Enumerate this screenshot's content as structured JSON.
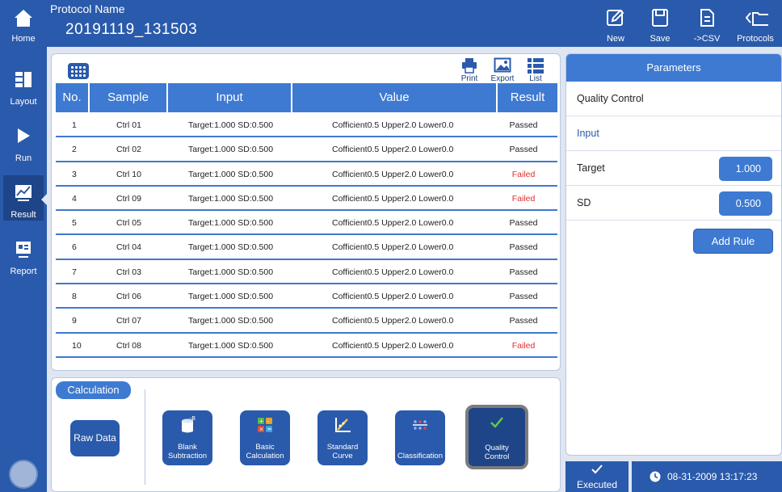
{
  "header": {
    "home_label": "Home",
    "protocol_caption": "Protocol Name",
    "protocol_name": "20191119_131503",
    "buttons": [
      {
        "label": "New",
        "icon": "edit-icon"
      },
      {
        "label": "Save",
        "icon": "save-icon"
      },
      {
        "label": "->CSV",
        "icon": "document-icon"
      },
      {
        "label": "Protocols",
        "icon": "folder-back-icon"
      }
    ]
  },
  "sidebar": {
    "items": [
      {
        "label": "Layout",
        "icon": "layout-icon"
      },
      {
        "label": "Run",
        "icon": "play-icon"
      },
      {
        "label": "Result",
        "icon": "chart-icon",
        "active": true
      },
      {
        "label": "Report",
        "icon": "report-icon"
      }
    ]
  },
  "toolbar": {
    "print_label": "Print",
    "export_label": "Export",
    "list_label": "List"
  },
  "table": {
    "columns": [
      "No.",
      "Sample",
      "Input",
      "Value",
      "Result"
    ],
    "rows": [
      {
        "no": "1",
        "sample": "Ctrl 01",
        "input": "Target:1.000  SD:0.500",
        "value": "Cofficient0.5  Upper2.0  Lower0.0",
        "result": "Passed"
      },
      {
        "no": "2",
        "sample": "Ctrl 02",
        "input": "Target:1.000  SD:0.500",
        "value": "Cofficient0.5  Upper2.0  Lower0.0",
        "result": "Passed"
      },
      {
        "no": "3",
        "sample": "Ctrl 10",
        "input": "Target:1.000  SD:0.500",
        "value": "Cofficient0.5  Upper2.0  Lower0.0",
        "result": "Failed"
      },
      {
        "no": "4",
        "sample": "Ctrl 09",
        "input": "Target:1.000  SD:0.500",
        "value": "Cofficient0.5  Upper2.0  Lower0.0",
        "result": "Failed"
      },
      {
        "no": "5",
        "sample": "Ctrl 05",
        "input": "Target:1.000  SD:0.500",
        "value": "Cofficient0.5  Upper2.0  Lower0.0",
        "result": "Passed"
      },
      {
        "no": "6",
        "sample": "Ctrl 04",
        "input": "Target:1.000  SD:0.500",
        "value": "Cofficient0.5  Upper2.0  Lower0.0",
        "result": "Passed"
      },
      {
        "no": "7",
        "sample": "Ctrl 03",
        "input": "Target:1.000  SD:0.500",
        "value": "Cofficient0.5  Upper2.0  Lower0.0",
        "result": "Passed"
      },
      {
        "no": "8",
        "sample": "Ctrl 06",
        "input": "Target:1.000  SD:0.500",
        "value": "Cofficient0.5  Upper2.0  Lower0.0",
        "result": "Passed"
      },
      {
        "no": "9",
        "sample": "Ctrl 07",
        "input": "Target:1.000  SD:0.500",
        "value": "Cofficient0.5  Upper2.0  Lower0.0",
        "result": "Passed"
      },
      {
        "no": "10",
        "sample": "Ctrl 08",
        "input": "Target:1.000  SD:0.500",
        "value": "Cofficient0.5  Upper2.0  Lower0.0",
        "result": "Failed"
      }
    ]
  },
  "calculation": {
    "tab_label": "Calculation",
    "raw_data_label": "Raw Data",
    "buttons": [
      {
        "line1": "Blank",
        "line2": "Subtraction",
        "icon": "blank-subtraction-icon"
      },
      {
        "line1": "Basic",
        "line2": "Calculation",
        "icon": "calculator-icon"
      },
      {
        "line1": "Standard",
        "line2": "Curve",
        "icon": "standard-curve-icon"
      },
      {
        "line1": "",
        "line2": "Classification",
        "icon": "classification-icon"
      },
      {
        "line1": "Quality",
        "line2": "Control",
        "icon": "checkmark-icon",
        "selected": true
      }
    ]
  },
  "parameters": {
    "title": "Parameters",
    "section": "Quality Control",
    "input_heading": "Input",
    "target_label": "Target",
    "target_value": "1.000",
    "sd_label": "SD",
    "sd_value": "0.500",
    "add_rule_label": "Add Rule"
  },
  "status": {
    "executed_label": "Executed",
    "datetime": "08-31-2009 13:17:23"
  },
  "colors": {
    "primary": "#2a5aab",
    "header_blue": "#3e7ad1",
    "failed": "#e03030",
    "background": "#dfe6f2"
  }
}
